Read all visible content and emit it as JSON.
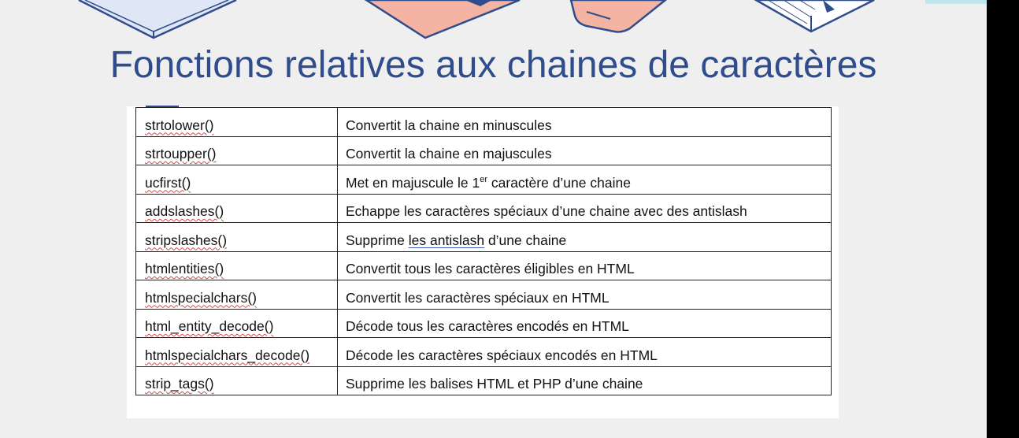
{
  "slide": {
    "title": "Fonctions relatives aux chaines de caractères",
    "colors": {
      "title": "#2f4d8c",
      "background": "#efefef",
      "accent_teal": "#bfe6ec",
      "salmon": "#f5b3a3"
    }
  },
  "table": {
    "rows": [
      {
        "function": "strtolower()",
        "description": "Convertit la chaine en minuscules"
      },
      {
        "function": "strtoupper()",
        "description": "Convertit la chaine en majuscules"
      },
      {
        "function": "ucfirst()",
        "description_before": "Met en majuscule le 1",
        "description_sup": "er",
        "description_after": " caractère d’une chaine"
      },
      {
        "function": "addslashes()",
        "description": "Echappe les caractères spéciaux d’une chaine avec des antislash"
      },
      {
        "function": "stripslashes()",
        "description_before": "Supprime ",
        "description_underlined": "les antislash",
        "description_after": " d’une chaine"
      },
      {
        "function": "htmlentities()",
        "description": "Convertit tous les caractères éligibles en HTML"
      },
      {
        "function": "htmlspecialchars()",
        "description": "Convertit les caractères spéciaux en HTML"
      },
      {
        "function": "html_entity_decode()",
        "description": "Décode tous les caractères encodés en HTML"
      },
      {
        "function": "htmlspecialchars_decode()",
        "description": "Décode les caractères spéciaux encodés en HTML"
      },
      {
        "function": "strip_tags()",
        "description": "Supprime les balises HTML et PHP d’une chaine"
      }
    ]
  }
}
